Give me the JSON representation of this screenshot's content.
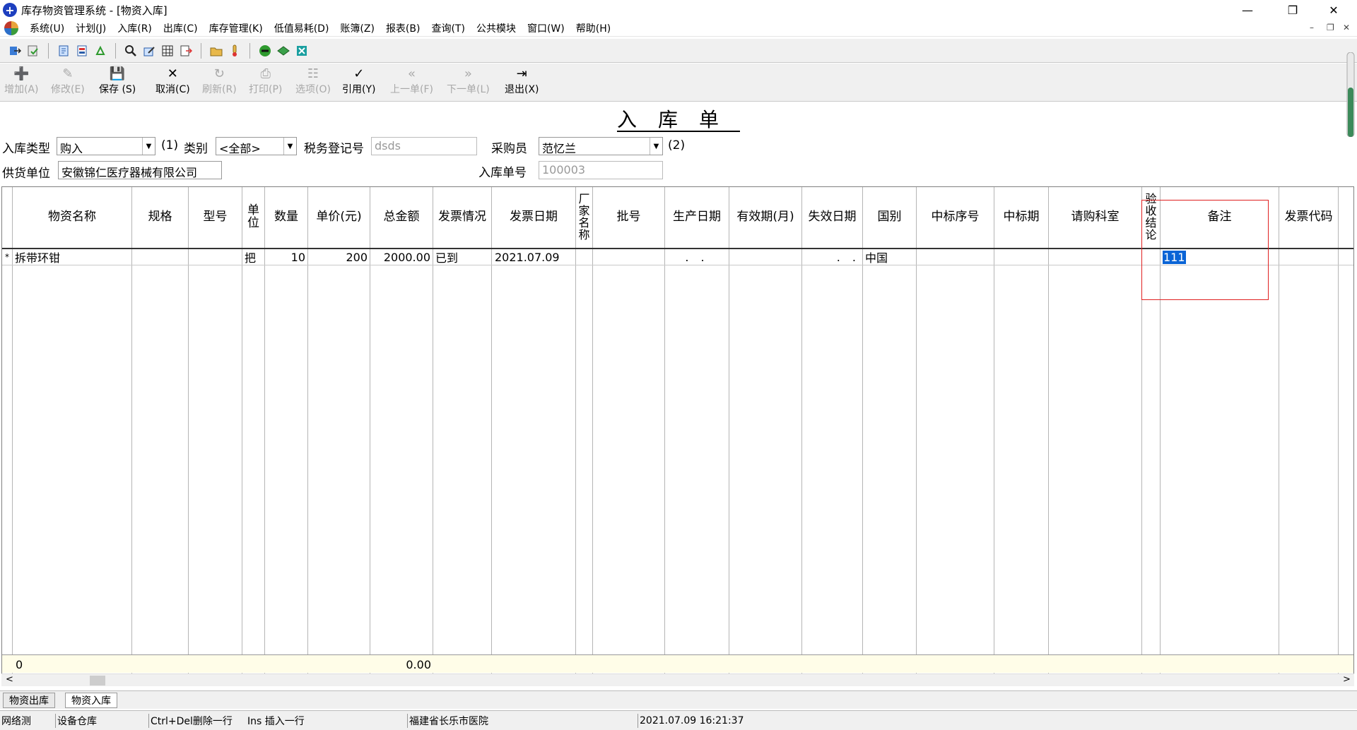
{
  "window": {
    "title": "库存物资管理系统 - [物资入库]",
    "icon_glyph": "+",
    "minimize_glyph": "—",
    "restore_glyph": "❐",
    "close_glyph": "✕"
  },
  "menu": {
    "items": [
      "系统(U)",
      "计划(J)",
      "入库(R)",
      "出库(C)",
      "库存管理(K)",
      "低值易耗(D)",
      "账簿(Z)",
      "报表(B)",
      "查询(T)",
      "公共模块",
      "窗口(W)",
      "帮助(H)"
    ],
    "mdi_min": "–",
    "mdi_restore": "❐",
    "mdi_close": "✕"
  },
  "toolbar_icons": [
    "login-icon",
    "refresh-check-icon",
    "document-icon",
    "report-icon",
    "recycle-icon",
    "search-icon",
    "edit-icon",
    "grid-icon",
    "export-icon",
    "folder-icon",
    "thermometer-icon",
    "minus-circle-icon",
    "book-icon",
    "calculator-icon"
  ],
  "commands": {
    "add": {
      "icon": "➕",
      "label": "增加(A)"
    },
    "modify": {
      "icon": "✎",
      "label": "修改(E)"
    },
    "save": {
      "icon": "💾",
      "label": "保存 (S)"
    },
    "cancel": {
      "icon": "✕",
      "label": "取消(C)"
    },
    "refresh": {
      "icon": "↻",
      "label": "刷新(R)"
    },
    "print": {
      "icon": "⎙",
      "label": "打印(P)"
    },
    "options": {
      "icon": "☷",
      "label": "选项(O)"
    },
    "cite": {
      "icon": "✓",
      "label": "引用(Y)"
    },
    "prev": {
      "icon": "«",
      "label": "上一单(F)"
    },
    "next": {
      "icon": "»",
      "label": "下一单(L)"
    },
    "exit": {
      "icon": "⇥",
      "label": "退出(X)"
    }
  },
  "form": {
    "title": "入库单",
    "entry_type_label": "入库类型",
    "entry_type_value": "购入",
    "marker1": "(1)",
    "category_label": "类别",
    "category_value": "<全部>",
    "tax_label": "税务登记号",
    "tax_value": "dsds",
    "buyer_label": "采购员",
    "buyer_value": "范忆兰",
    "marker2": "(2)",
    "supplier_label": "供货单位",
    "supplier_value": "安徽锦仁医疗器械有限公司",
    "order_no_label": "入库单号",
    "order_no_value": "100003"
  },
  "grid": {
    "headers": {
      "name": "物资名称",
      "spec": "规格",
      "model": "型号",
      "unit": "单\n位",
      "qty": "数量",
      "price": "单价(元)",
      "total": "总金额",
      "invoice_status": "发票情况",
      "invoice_date": "发票日期",
      "maker": "厂\n家\n名\n称",
      "batch": "批号",
      "prod_date": "生产日期",
      "validity": "有效期(月)",
      "expire": "失效日期",
      "country": "国别",
      "bid_no": "中标序号",
      "bid_period": "中标期",
      "dept": "请购科室",
      "accept": "验\n收\n结\n论",
      "note": "备注",
      "invoice_code": "发票代码"
    },
    "row": {
      "marker": "*",
      "name": "拆带环钳",
      "unit": "把",
      "qty": "10",
      "price": "200",
      "total": "2000.00",
      "invoice_status": "已到",
      "invoice_date": "2021.07.09",
      "prod_date": ". .",
      "expire": ". .",
      "country": "中国",
      "note": "111"
    },
    "totals": {
      "count": "0",
      "total": "0.00"
    }
  },
  "scroll": {
    "left_glyph": "<",
    "right_glyph": ">"
  },
  "tabs": [
    "物资出库",
    "物资入库"
  ],
  "status": {
    "s1": "网络测",
    "s2": "设备仓库",
    "s3": "Ctrl+Del删除一行",
    "s4": "Ins 插入一行",
    "s5": "福建省长乐市医院",
    "s6": "2021.07.09 16:21:37"
  }
}
